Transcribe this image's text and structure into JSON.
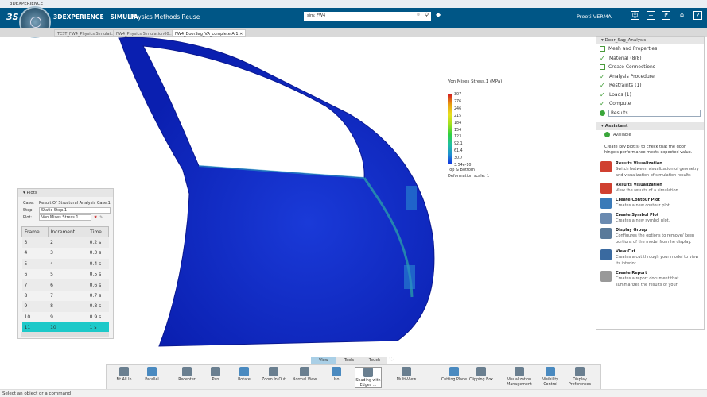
{
  "window": {
    "title": "3DEXPERIENCE"
  },
  "header": {
    "brand": "3DEXPERIENCE | SIMULIA",
    "app": "Physics Methods Reuse",
    "search_value": "sim: FW4",
    "user": "Preeti VERMA"
  },
  "tabs": [
    {
      "label": "TEST_FW4_Physics Simulat..."
    },
    {
      "label": "FW4_Physics Simulation00..."
    },
    {
      "label": "FW4_DoorSag_VA_complete A.1"
    }
  ],
  "legend": {
    "title": "Von Mises Stress.1 (MPa)",
    "values": [
      "307",
      "276",
      "246",
      "215",
      "184",
      "154",
      "123",
      "92.1",
      "61.4",
      "30.7",
      "3.54e-10"
    ],
    "note1": "Top & Bottom",
    "note2": "Deformation scale: 1",
    "colors": [
      "#d42020",
      "#e8a010",
      "#e8e020",
      "#a0e020",
      "#30d040",
      "#20c0a0",
      "#2090d0",
      "#1030e0"
    ]
  },
  "right_panel": {
    "title": "Door_Sag_Analysis",
    "steps": [
      {
        "label": "Mesh and Properties",
        "state": "box"
      },
      {
        "label": "Material (8/8)",
        "state": "check"
      },
      {
        "label": "Create Connections",
        "state": "box"
      },
      {
        "label": "Analysis Procedure",
        "state": "check"
      },
      {
        "label": "Restraints (1)",
        "state": "check"
      },
      {
        "label": "Loads (1)",
        "state": "check"
      },
      {
        "label": "Compute",
        "state": "check"
      },
      {
        "label": "Results",
        "state": "current"
      }
    ],
    "assistant_title": "Assistant",
    "status": "Available",
    "hint": "Create key plot(s) to check that the door hinge's performance meets expected value.",
    "tools": [
      {
        "title": "Results Visualization",
        "desc": "Switch between visualization of geometry and visualization of simulation results",
        "icon": "results-visualization-icon"
      },
      {
        "title": "Results Visualization",
        "desc": "View the results of a simulation.",
        "icon": "results-visualization-icon"
      },
      {
        "title": "Create Contour Plot",
        "desc": "Creates a new contour plot.",
        "icon": "contour-plot-icon"
      },
      {
        "title": "Create Symbol Plot",
        "desc": "Creates a new symbol plot.",
        "icon": "symbol-plot-icon"
      },
      {
        "title": "Display Group",
        "desc": "Configures the options to remove/ keep portions of the model from he display.",
        "icon": "display-group-icon"
      },
      {
        "title": "View Cut",
        "desc": "Creates a cut through your model to view its interior.",
        "icon": "view-cut-icon"
      },
      {
        "title": "Create Report",
        "desc": "Creates a report document that summarizes the results of your",
        "icon": "report-icon"
      }
    ]
  },
  "plots": {
    "title": "Plots",
    "case_label": "Case:",
    "case": "Result Of Structural Analysis Case.1",
    "step_label": "Step:",
    "step": "Static Step.1",
    "plot_label": "Plot:",
    "plot": "Von Mises Stress.1",
    "columns": [
      "Frame",
      "Increment",
      "Time"
    ],
    "rows": [
      [
        "3",
        "2",
        "0.2 s"
      ],
      [
        "4",
        "3",
        "0.3 s"
      ],
      [
        "5",
        "4",
        "0.4 s"
      ],
      [
        "6",
        "5",
        "0.5 s"
      ],
      [
        "7",
        "6",
        "0.6 s"
      ],
      [
        "8",
        "7",
        "0.7 s"
      ],
      [
        "9",
        "8",
        "0.8 s"
      ],
      [
        "10",
        "9",
        "0.9 s"
      ],
      [
        "11",
        "10",
        "1 s"
      ]
    ],
    "selected_row": 8
  },
  "toolbar": {
    "tabs": [
      "View",
      "Tools",
      "Touch"
    ],
    "active_tab": "View",
    "buttons": [
      {
        "label": "Fit All In",
        "icon": "fit-all-icon"
      },
      {
        "label": "Parallel",
        "icon": "parallel-icon"
      },
      {
        "label": "Recenter",
        "icon": "recenter-icon"
      },
      {
        "label": "Pan",
        "icon": "pan-icon"
      },
      {
        "label": "Rotate",
        "icon": "rotate-icon"
      },
      {
        "label": "Zoom In Out",
        "icon": "zoom-icon"
      },
      {
        "label": "Normal View",
        "icon": "normal-view-icon"
      },
      {
        "label": "Iso",
        "icon": "iso-icon"
      },
      {
        "label": "Shading with Edges ...",
        "icon": "shading-icon"
      },
      {
        "label": "Multi-View",
        "icon": "multi-view-icon"
      },
      {
        "label": "Cutting Plane",
        "icon": "cutting-plane-icon"
      },
      {
        "label": "Clipping Box",
        "icon": "clipping-box-icon"
      },
      {
        "label": "Visualization Management",
        "icon": "visualization-management-icon"
      },
      {
        "label": "Visibility Control",
        "icon": "visibility-control-icon"
      },
      {
        "label": "Display Preferences",
        "icon": "display-preferences-icon"
      }
    ]
  },
  "status": {
    "text": "Select an object or a command"
  }
}
